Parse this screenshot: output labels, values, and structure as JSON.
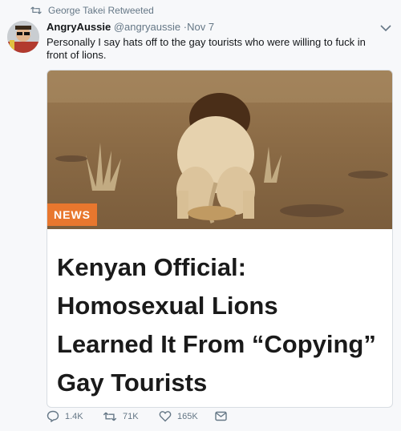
{
  "retweet_label": "George Takei Retweeted",
  "tweet": {
    "display_name": "AngryAussie",
    "handle": "@angryaussie",
    "separator": "·",
    "time": "Nov 7",
    "text": "Personally I say hats off to the gay tourists who were willing to fuck in front of lions."
  },
  "card": {
    "badge": "NEWS",
    "headline": "Kenyan Official: Homosexual Lions Learned It From “Copying” Gay Tourists"
  },
  "actions": {
    "replies": "1.4K",
    "retweets": "71K",
    "likes": "165K"
  },
  "colors": {
    "badge": "#e8772e",
    "muted": "#657786",
    "background": "#f7f8fa"
  }
}
